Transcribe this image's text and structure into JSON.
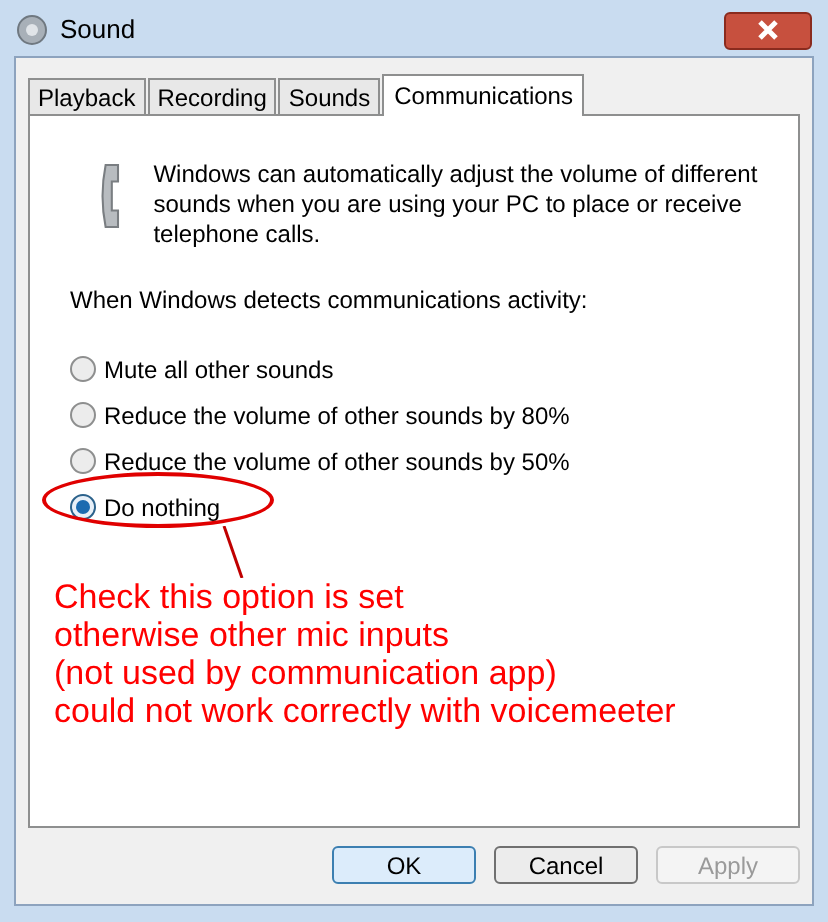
{
  "window": {
    "title": "Sound"
  },
  "tabs": [
    {
      "label": "Playback",
      "selected": false
    },
    {
      "label": "Recording",
      "selected": false
    },
    {
      "label": "Sounds",
      "selected": false
    },
    {
      "label": "Communications",
      "selected": true
    }
  ],
  "description": "Windows can automatically adjust the volume of different sounds when you are using your PC to place or receive telephone calls.",
  "prompt": "When Windows detects communications activity:",
  "options": [
    {
      "label": "Mute all other sounds",
      "selected": false
    },
    {
      "label": "Reduce the volume of other sounds by 80%",
      "selected": false
    },
    {
      "label": "Reduce the volume of other sounds by 50%",
      "selected": false
    },
    {
      "label": "Do nothing",
      "selected": true
    }
  ],
  "annotation": {
    "lines": [
      "Check this option is set",
      "otherwise other mic inputs",
      "(not used by communication app)",
      "could not work correctly with voicemeeter"
    ]
  },
  "buttons": [
    {
      "label": "OK",
      "kind": "default",
      "disabled": false
    },
    {
      "label": "Cancel",
      "kind": "normal",
      "disabled": false
    },
    {
      "label": "Apply",
      "kind": "normal",
      "disabled": true
    }
  ]
}
